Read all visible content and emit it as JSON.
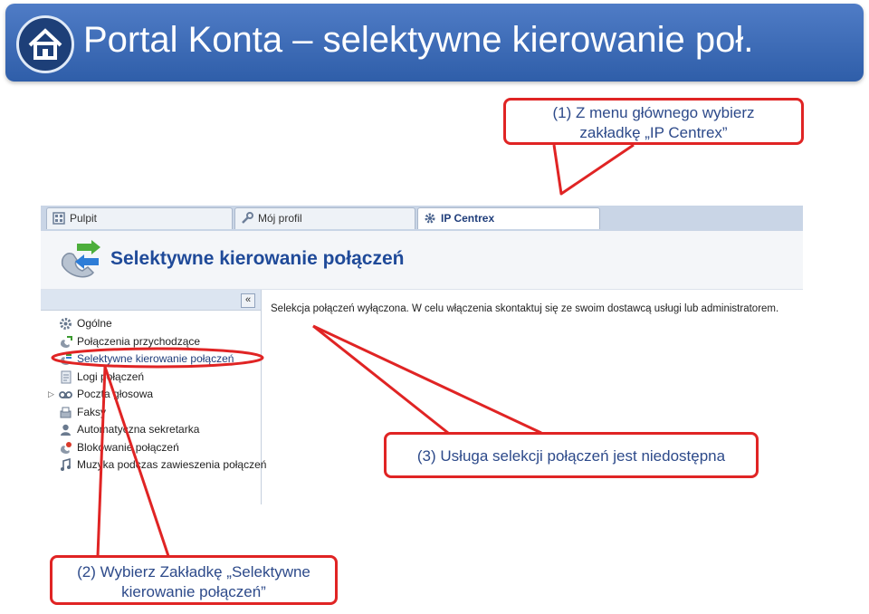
{
  "slide": {
    "title": "Portal Konta – selektywne kierowanie poł."
  },
  "callouts": {
    "step1_line1": "(1) Z menu głównego wybierz",
    "step1_line2": "zakładkę „IP Centrex”",
    "step2_line1": "(2) Wybierz Zakładkę „Selektywne",
    "step2_line2": "kierowanie połączeń”",
    "step3": "(3) Usługa selekcji połączeń jest niedostępna"
  },
  "tabs": [
    {
      "label": "Pulpit",
      "icon": "dashboard-icon"
    },
    {
      "label": "Mój profil",
      "icon": "wrench-icon"
    },
    {
      "label": "IP Centrex",
      "icon": "gear-icon"
    }
  ],
  "page": {
    "title": "Selektywne kierowanie połączeń",
    "collapse": "«",
    "message": "Selekcja połączeń wyłączona. W celu włączenia skontaktuj się ze swoim dostawcą usługi lub administratorem."
  },
  "menu": [
    {
      "label": "Ogólne",
      "icon": "gear-icon"
    },
    {
      "label": "Połączenia przychodzące",
      "icon": "incoming-call-icon"
    },
    {
      "label": "Selektywne kierowanie połączeń",
      "icon": "routing-icon"
    },
    {
      "label": "Logi połączeń",
      "icon": "log-icon"
    },
    {
      "label": "Poczta głosowa",
      "icon": "voicemail-icon"
    },
    {
      "label": "Faksy",
      "icon": "fax-icon"
    },
    {
      "label": "Automatyczna sekretarka",
      "icon": "secretary-icon"
    },
    {
      "label": "Blokowanie połączeń",
      "icon": "block-icon"
    },
    {
      "label": "Muzyka podczas zawieszenia połączeń",
      "icon": "music-icon"
    }
  ],
  "colors": {
    "banner": "#3a6bb8",
    "callout_border": "#e02424",
    "callout_text": "#2d4a8a"
  }
}
